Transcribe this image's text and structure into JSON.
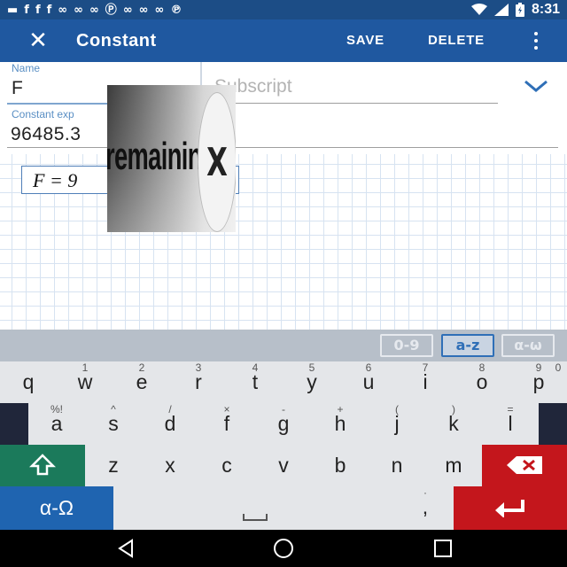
{
  "status_bar": {
    "icons": [
      "notification-icon",
      "facebook-icon",
      "facebook-icon",
      "facebook-icon",
      "app-icon",
      "app-icon",
      "app-icon",
      "p-icon",
      "app-icon",
      "app-icon",
      "app-icon",
      "pinterest-icon"
    ],
    "time": "8:31",
    "right_icons": [
      "wifi-icon",
      "signal-icon",
      "battery-icon"
    ]
  },
  "app_bar": {
    "title": "Constant",
    "save_label": "SAVE",
    "delete_label": "DELETE",
    "background": "#1f58a0"
  },
  "form": {
    "name_label": "Name",
    "name_value": "F",
    "subscript_placeholder": "Subscript",
    "expression_label": "Constant exp",
    "expression_value": "96485.3"
  },
  "preview": {
    "text": "F = 9"
  },
  "ad": {
    "text": "remaining",
    "close_glyph": "X"
  },
  "keyboard": {
    "modes": [
      "0-9",
      "a-z",
      "α-ω"
    ],
    "active_mode": "a-z",
    "row1": [
      {
        "main": "q",
        "hint": ""
      },
      {
        "main": "w",
        "hint": "1"
      },
      {
        "main": "e",
        "hint": "2"
      },
      {
        "main": "r",
        "hint": "3"
      },
      {
        "main": "t",
        "hint": "4"
      },
      {
        "main": "y",
        "hint": "5"
      },
      {
        "main": "u",
        "hint": "6"
      },
      {
        "main": "i",
        "hint": "7"
      },
      {
        "main": "o",
        "hint": "8"
      },
      {
        "main": "p",
        "hint": "9"
      }
    ],
    "row1_last_hint": "0",
    "row2": [
      {
        "main": "a",
        "hint": "%!"
      },
      {
        "main": "s",
        "hint": "^"
      },
      {
        "main": "d",
        "hint": "/"
      },
      {
        "main": "f",
        "hint": "×"
      },
      {
        "main": "g",
        "hint": "-"
      },
      {
        "main": "h",
        "hint": "+"
      },
      {
        "main": "j",
        "hint": "("
      },
      {
        "main": "k",
        "hint": ")"
      },
      {
        "main": "l",
        "hint": "="
      }
    ],
    "row3": [
      "z",
      "x",
      "c",
      "v",
      "b",
      "n",
      "m"
    ],
    "alpha_label": "α-Ω",
    "comma_label": ",",
    "comma_hint": "·"
  }
}
